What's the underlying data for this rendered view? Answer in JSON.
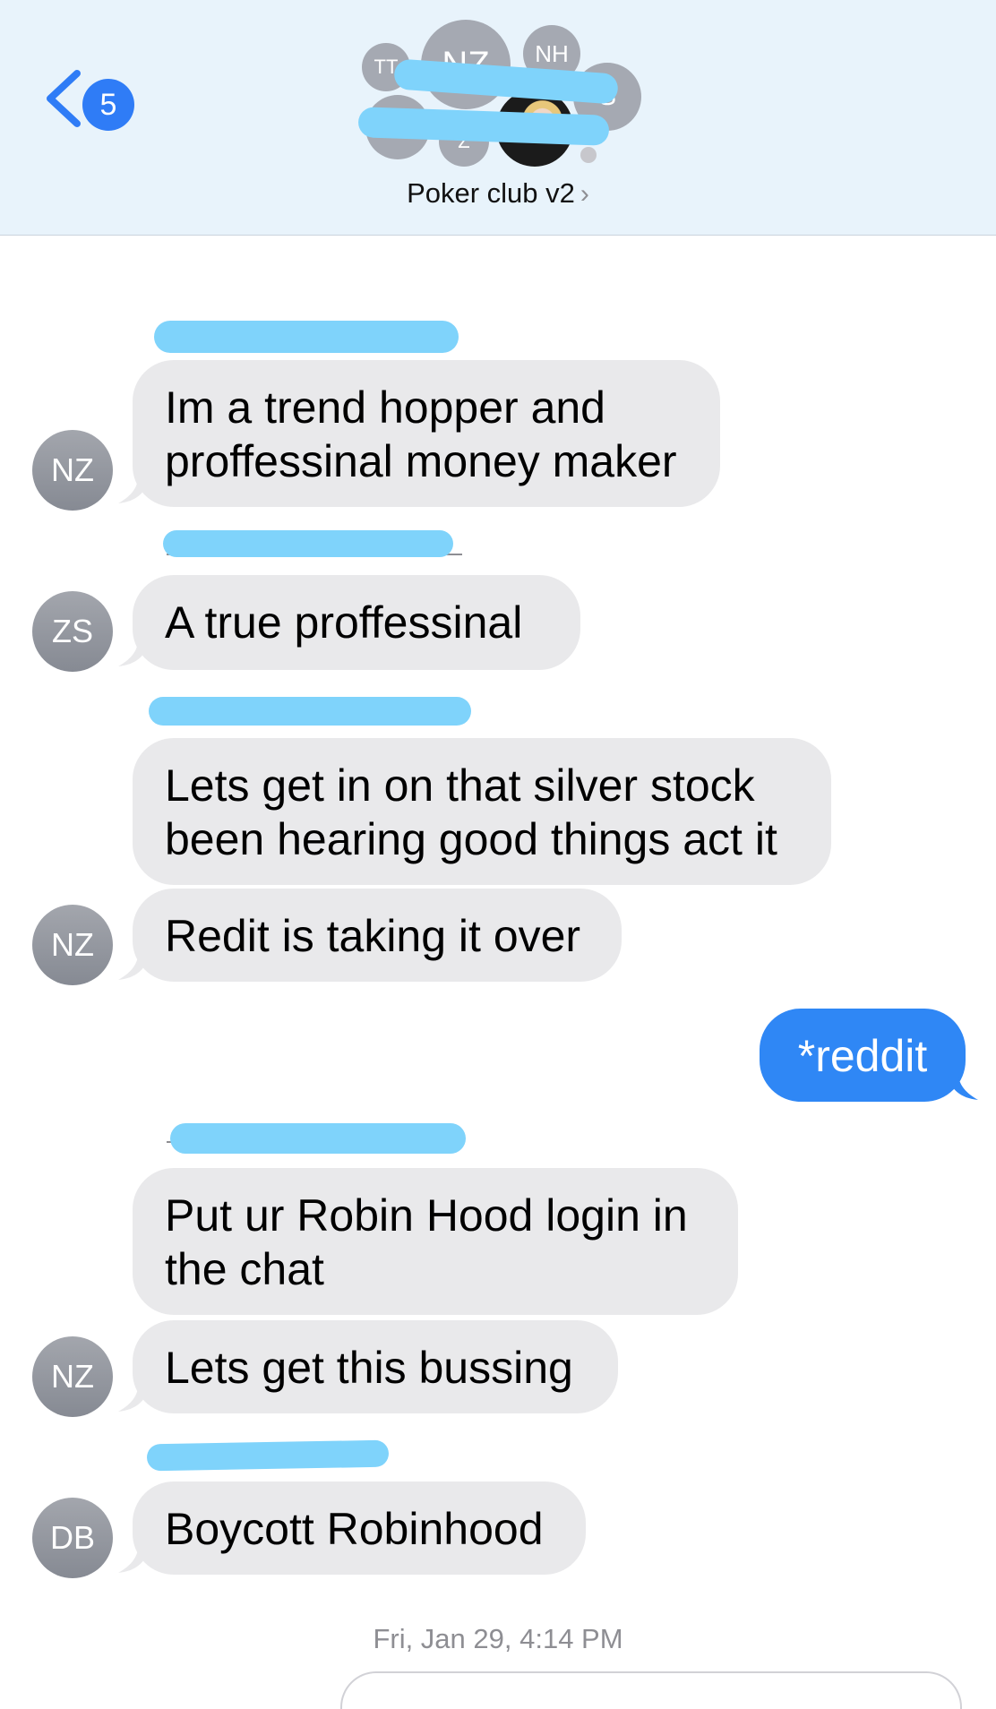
{
  "header": {
    "back_badge": "5",
    "group_name": "Poker club v2",
    "chevron": "›",
    "member_initials": [
      "TT",
      "NZ",
      "NH",
      "S",
      "Z"
    ]
  },
  "messages": [
    {
      "text": "Im a trend hopper and\nproffessinal money maker",
      "avatar": "NZ"
    },
    {
      "text": "A true proffessinal",
      "avatar": "ZS"
    },
    {
      "text": "Lets get in on that silver stock\nbeen hearing good things act it"
    },
    {
      "text": "Redit is taking it over",
      "avatar": "NZ"
    },
    {
      "text": "*reddit",
      "sent": true
    },
    {
      "text": "Put ur Robin Hood login in\nthe  chat"
    },
    {
      "text": "Lets get this bussing",
      "avatar": "NZ"
    },
    {
      "text": "Boycott Robinhood",
      "avatar": "DB"
    }
  ],
  "timestamp": "Fri, Jan 29, 4:14 PM",
  "colors": {
    "header_bg": "#e8f3fb",
    "received_bubble": "#e9e9eb",
    "sent_bubble": "#2f87f5",
    "accent": "#2f7cf6",
    "redaction": "#7fd3fb"
  }
}
